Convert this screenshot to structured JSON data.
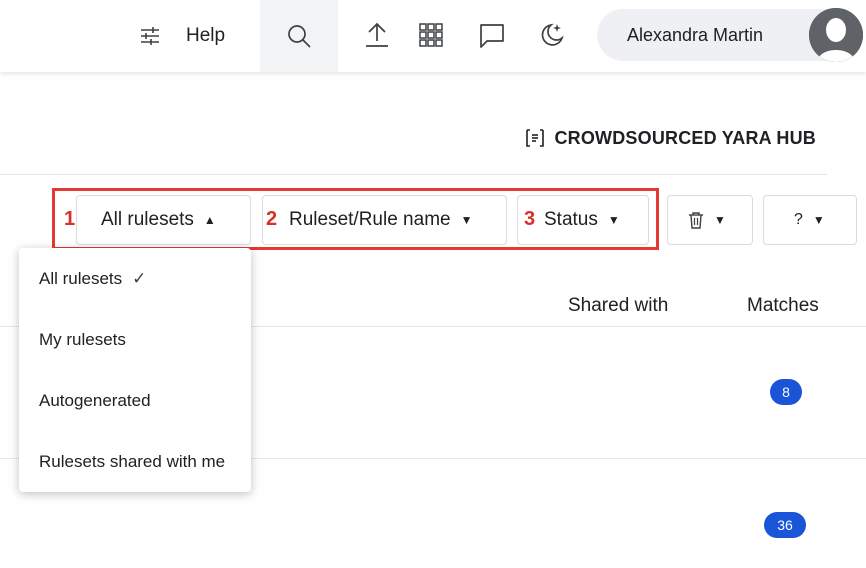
{
  "topbar": {
    "help_label": "Help",
    "icons": [
      "filter-sliders-icon",
      "search-icon",
      "upload-icon",
      "apps-grid-icon",
      "chat-icon",
      "dark-mode-icon"
    ],
    "user_name": "Alexandra Martin"
  },
  "page": {
    "hub_title": "CROWDSOURCED YARA HUB"
  },
  "filters": {
    "marker_1": "1",
    "marker_2": "2",
    "marker_3": "3",
    "rulesets_label": "All rulesets",
    "rule_name_label": "Ruleset/Rule name",
    "status_label": "Status",
    "help_label": "?",
    "highlight_color": "#e53935"
  },
  "dropdown": {
    "items": [
      {
        "label": "All rulesets",
        "selected": true
      },
      {
        "label": "My rulesets",
        "selected": false
      },
      {
        "label": "Autogenerated",
        "selected": false
      },
      {
        "label": "Rulesets shared with me",
        "selected": false
      }
    ]
  },
  "table": {
    "headers": {
      "shared_with": "Shared with",
      "matches": "Matches"
    },
    "rows": [
      {
        "matches": "8"
      },
      {
        "matches": "36"
      }
    ],
    "badge_color": "#1a55d8"
  }
}
